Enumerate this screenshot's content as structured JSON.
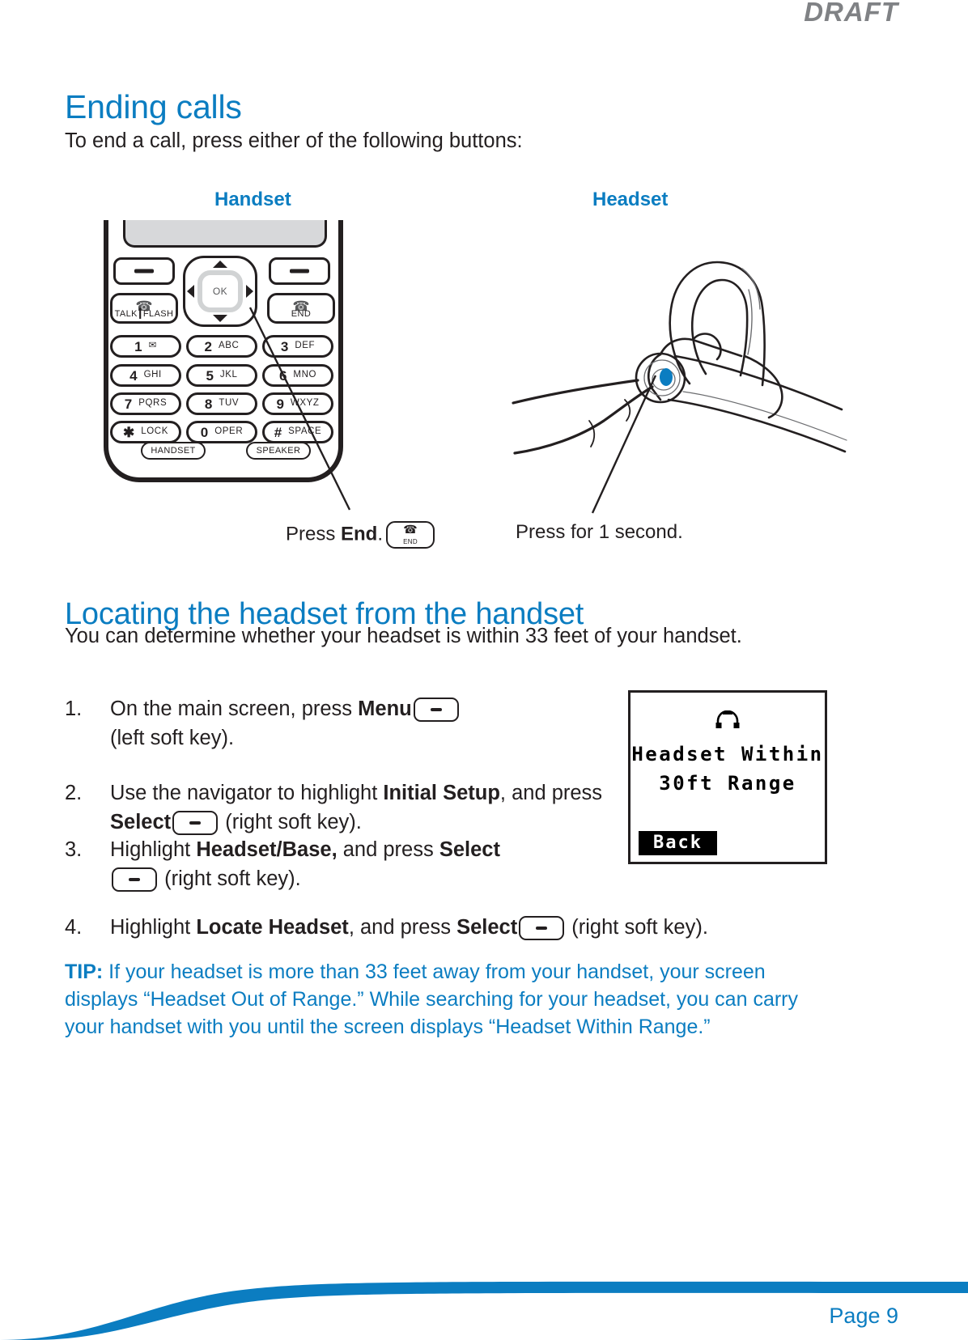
{
  "watermark": "DRAFT",
  "sections": {
    "ending_calls": {
      "heading": "Ending calls",
      "intro": "To end a call, press either of the following buttons:"
    },
    "locating": {
      "heading": "Locating the headset from the handset",
      "intro": "You can determine whether your headset is within 33 feet of your handset."
    }
  },
  "figure": {
    "handset_caption": "Handset",
    "headset_caption": "Headset",
    "handset_note_prefix": "Press ",
    "handset_note_bold": "End",
    "handset_note_suffix": ".",
    "headset_note": "Press for 1 second.",
    "endkey_label": "END"
  },
  "handset_keypad": {
    "screen": "",
    "softkey_left": "-",
    "softkey_right": "-",
    "navigator_center": "OK",
    "talk_key": {
      "label_a": "TALK",
      "label_b": "FLASH",
      "icon": "phone-handset-icon"
    },
    "end_key": {
      "label": "END",
      "icon": "phone-handset-icon"
    },
    "keys": [
      {
        "digit": "1",
        "alpha": "✉"
      },
      {
        "digit": "2",
        "alpha": "ABC"
      },
      {
        "digit": "3",
        "alpha": "DEF"
      },
      {
        "digit": "4",
        "alpha": "GHI"
      },
      {
        "digit": "5",
        "alpha": "JKL"
      },
      {
        "digit": "6",
        "alpha": "MNO"
      },
      {
        "digit": "7",
        "alpha": "PQRS"
      },
      {
        "digit": "8",
        "alpha": "TUV"
      },
      {
        "digit": "9",
        "alpha": "WXYZ"
      },
      {
        "digit": "✱",
        "alpha": "LOCK"
      },
      {
        "digit": "0",
        "alpha": "OPER"
      },
      {
        "digit": "#",
        "alpha": "SPACE"
      }
    ],
    "bottom_keys": [
      "HANDSET",
      "SPEAKER"
    ]
  },
  "steps": [
    {
      "number": "1.",
      "parts": [
        {
          "t": "On the main screen, press ",
          "b": false
        },
        {
          "t": "Menu",
          "b": true
        },
        {
          "t": "__SOFTKEY__",
          "b": false
        },
        {
          "t": "(left soft key).",
          "b": false,
          "br": true
        }
      ]
    },
    {
      "number": "2.",
      "parts": [
        {
          "t": "Use the navigator to highlight ",
          "b": false
        },
        {
          "t": "Initial Setup",
          "b": true
        },
        {
          "t": ", and press ",
          "b": false
        },
        {
          "t": "Select",
          "b": true
        },
        {
          "t": "__SOFTKEY__",
          "b": false
        },
        {
          "t": " (right soft key).",
          "b": false
        }
      ]
    },
    {
      "number": "3.",
      "parts": [
        {
          "t": "Highlight ",
          "b": false
        },
        {
          "t": "Headset/Base,",
          "b": true
        },
        {
          "t": " and press ",
          "b": false
        },
        {
          "t": "Select",
          "b": true
        },
        {
          "t": "__SOFTKEY__",
          "b": false
        },
        {
          "t": " (right soft key).",
          "b": false
        }
      ]
    },
    {
      "number": "4.",
      "parts": [
        {
          "t": "Highlight ",
          "b": false
        },
        {
          "t": "Locate Headset",
          "b": true
        },
        {
          "t": ", and press ",
          "b": false
        },
        {
          "t": "Select",
          "b": true
        },
        {
          "t": "__SOFTKEY__",
          "b": false
        },
        {
          "t": " (right soft key).",
          "b": false
        }
      ]
    }
  ],
  "step_text": {
    "s1_a": "On the main screen, press ",
    "s1_bold": "Menu",
    "s1_b": "(left soft key).",
    "s2_a": "Use the navigator to highlight ",
    "s2_bold": "Initial Setup",
    "s2_b": ", and press ",
    "s2_bold2": "Select",
    "s2_c": " (right soft key).",
    "s3_a": "Highlight ",
    "s3_bold": "Headset/Base,",
    "s3_b": " and press ",
    "s3_bold2": "Select",
    "s3_c": " (right soft key).",
    "s4_a": "Highlight ",
    "s4_bold": "Locate Headset",
    "s4_b": ", and press ",
    "s4_bold2": "Select",
    "s4_c": " (right soft key).",
    "num1": "1.",
    "num2": "2.",
    "num3": "3.",
    "num4": "4."
  },
  "tip": {
    "label": "TIP:",
    "text": " If your headset is more than 33 feet away from your handset, your screen displays “Headset Out of Range.” While searching for your headset, you can carry your handset with you until the screen displays “Headset Within Range.”"
  },
  "lcd": {
    "icon": "headphones-icon",
    "line1": "Headset Within",
    "line2": "30ft Range",
    "softkey": "Back"
  },
  "footer": {
    "page": "Page 9"
  },
  "colors": {
    "accent_blue": "#0b7dc1",
    "ink": "#231f20",
    "grey": "#808285"
  }
}
